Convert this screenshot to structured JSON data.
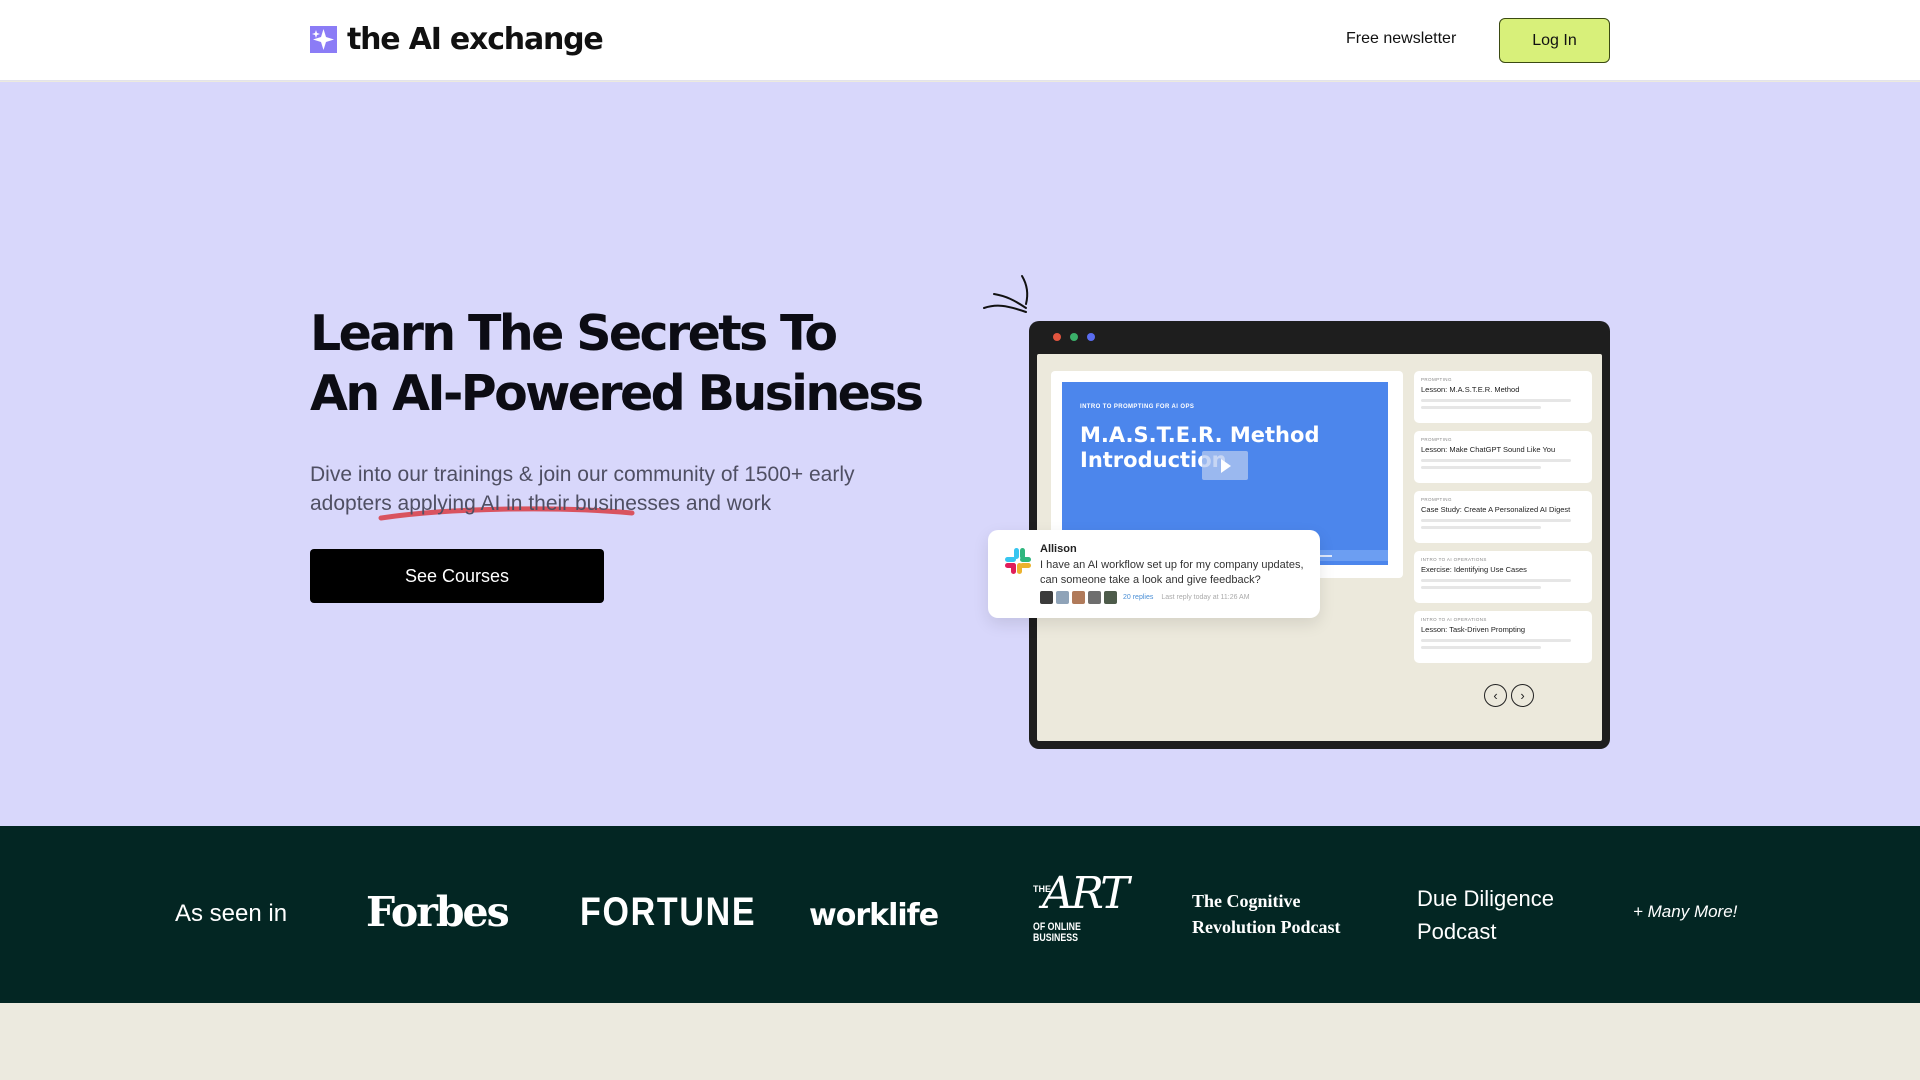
{
  "header": {
    "logo_text": "the AI exchange",
    "nav_newsletter": "Free newsletter",
    "login_label": "Log In"
  },
  "hero": {
    "title_line1": "Learn The Secrets To",
    "title_line2": "An AI-Powered Business",
    "subtitle": "Dive into our trainings & join our community of 1500+ early adopters applying AI in their businesses and work",
    "cta_label": "See Courses"
  },
  "mockup": {
    "window_dots": [
      "#e2553f",
      "#3bb06a",
      "#5a6df0"
    ],
    "video": {
      "tag": "INTRO TO PROMPTING FOR AI OPS",
      "title": "M.A.S.T.E.R. Method Introduction",
      "footer": "theaiexchange.com | Confidential Course Materials"
    },
    "lessons": [
      {
        "category": "PROMPTING",
        "title": "Lesson: M.A.S.T.E.R. Method"
      },
      {
        "category": "PROMPTING",
        "title": "Lesson: Make ChatGPT Sound Like You"
      },
      {
        "category": "PROMPTING",
        "title": "Case Study: Create A Personalized AI Digest"
      },
      {
        "category": "INTRO TO AI OPERATIONS",
        "title": "Exercise: Identifying Use Cases"
      },
      {
        "category": "INTRO TO AI OPERATIONS",
        "title": "Lesson: Task-Driven Prompting"
      }
    ],
    "chat": {
      "name": "Allison",
      "message": "I have an AI workflow set up for my company updates, can someone take a look and give feedback?",
      "replies": "20 replies",
      "last_reply": "Last reply today at 11:26 AM"
    }
  },
  "press": {
    "label": "As seen in",
    "outlets": [
      "Forbes",
      "FORTUNE",
      "worklife",
      "THE",
      "ART",
      "OF ONLINE BUSINESS",
      "The Cognitive Revolution Podcast",
      "Due Diligence Podcast"
    ],
    "more": "+ Many More!"
  },
  "colors": {
    "hero_bg": "#d8d7fb",
    "accent_login": "#d8f07a",
    "band_bg": "#032623",
    "underline": "#d9535f",
    "video_blue": "#4c86ec",
    "logo_purple": "#8b7cf6"
  },
  "icons": [
    "logo-sparkle-icon",
    "play-icon",
    "slack-icon",
    "arrow-left-icon",
    "arrow-right-icon",
    "spark-lines-icon"
  ]
}
